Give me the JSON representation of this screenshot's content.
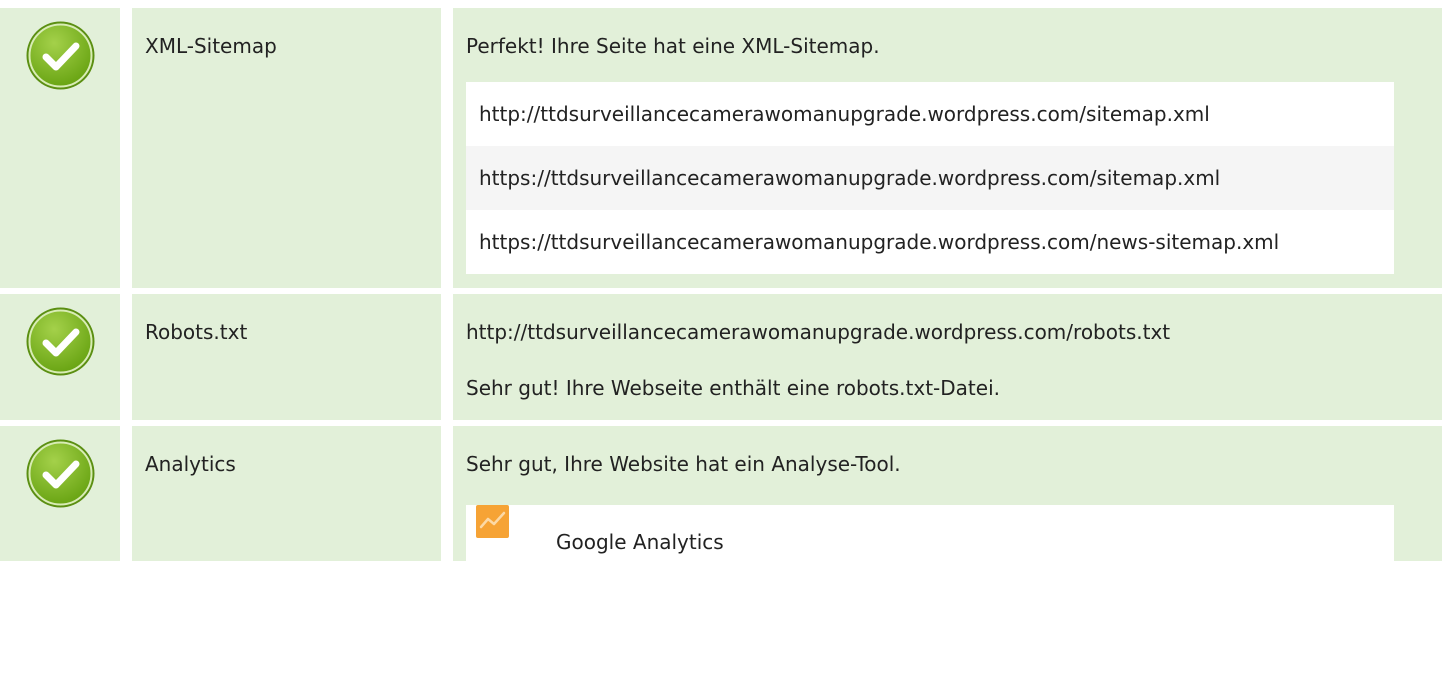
{
  "rows": [
    {
      "icon": "check-circle-icon",
      "label": "XML-Sitemap",
      "message": "Perfekt! Ihre Seite hat eine XML-Sitemap.",
      "urls": [
        "http://ttdsurveillancecamerawomanupgrade.wordpress.com/sitemap.xml",
        "https://ttdsurveillancecamerawomanupgrade.wordpress.com/sitemap.xml",
        "https://ttdsurveillancecamerawomanupgrade.wordpress.com/news-sitemap.xml"
      ]
    },
    {
      "icon": "check-circle-icon",
      "label": "Robots.txt",
      "url": "http://ttdsurveillancecamerawomanupgrade.wordpress.com/robots.txt",
      "message": "Sehr gut! Ihre Webseite enthält eine robots.txt-Datei."
    },
    {
      "icon": "check-circle-icon",
      "label": "Analytics",
      "message": "Sehr gut, Ihre Website hat ein Analyse-Tool.",
      "tool": {
        "icon": "google-analytics-icon",
        "name": "Google Analytics"
      }
    }
  ],
  "colors": {
    "row_background": "#e2f0d9",
    "check_green": "#7ab51d",
    "analytics_orange": "#f6a335"
  }
}
